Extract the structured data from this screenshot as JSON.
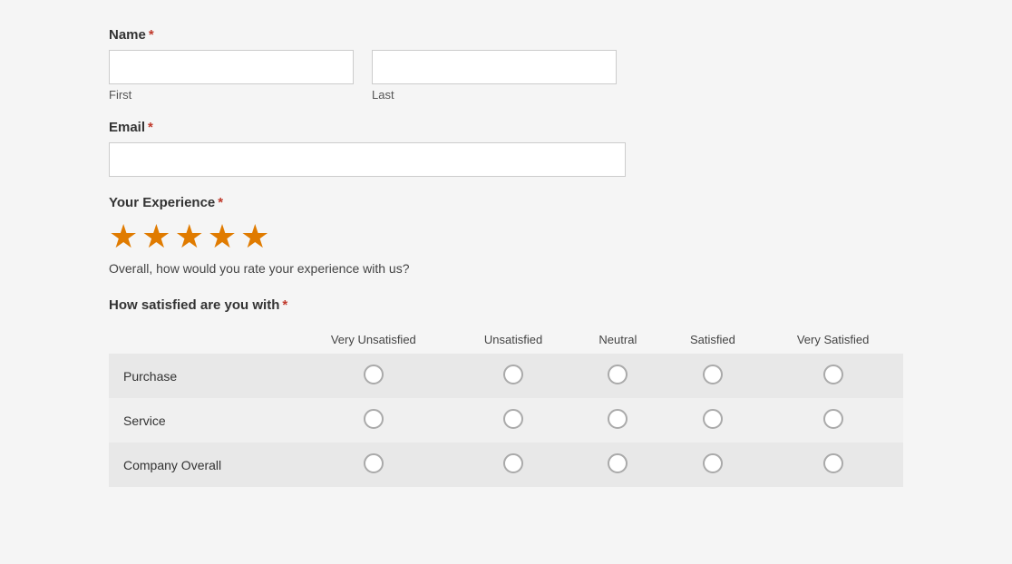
{
  "form": {
    "name_label": "Name",
    "required_marker": "*",
    "first_label": "First",
    "last_label": "Last",
    "first_placeholder": "",
    "last_placeholder": "",
    "email_label": "Email",
    "email_placeholder": "",
    "experience_label": "Your Experience",
    "stars": [
      "★",
      "★",
      "★",
      "★",
      "★"
    ],
    "experience_description": "Overall, how would you rate your experience with us?",
    "satisfaction_label": "How satisfied are you with",
    "columns": [
      "",
      "Very Unsatisfied",
      "Unsatisfied",
      "Neutral",
      "Satisfied",
      "Very Satisfied"
    ],
    "rows": [
      {
        "label": "Purchase"
      },
      {
        "label": "Service"
      },
      {
        "label": "Company Overall"
      }
    ]
  }
}
